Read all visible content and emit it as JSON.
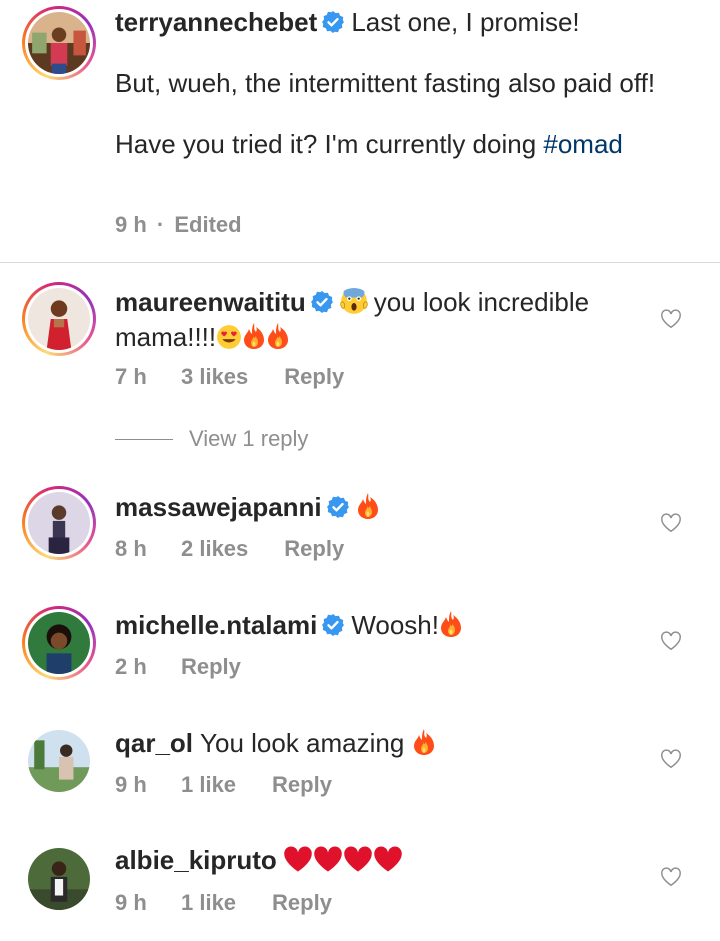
{
  "caption": {
    "username": "terryannechebet",
    "line1": "Last one, I promise!",
    "line2": "But, wueh, the intermittent fasting  also paid off!",
    "line3_prefix": "Have you tried it? I'm currently doing ",
    "hashtag": "#omad",
    "time": "9 h",
    "separator": "·",
    "edited": "Edited"
  },
  "comments": [
    {
      "username": "maureenwaititu",
      "text_prefix": "you look incredible mama!!!!",
      "time": "7 h",
      "likes": "3 likes",
      "reply": "Reply",
      "view_replies": "View 1 reply"
    },
    {
      "username": "massawejapanni",
      "time": "8 h",
      "likes": "2 likes",
      "reply": "Reply"
    },
    {
      "username": "michelle.ntalami",
      "text": "Woosh!",
      "time": "2 h",
      "reply": "Reply"
    },
    {
      "username": "qar_ol",
      "text": "You look amazing ",
      "time": "9 h",
      "likes": "1 like",
      "reply": "Reply"
    },
    {
      "username": "albie_kipruto",
      "time": "9 h",
      "likes": "1 like",
      "reply": "Reply"
    }
  ],
  "colors": {
    "verified": "#3897f0",
    "text": "#262626",
    "meta": "#8e8e8e",
    "hashtag": "#00376b"
  },
  "icons": [
    "verified-badge-icon",
    "heart-outline-icon",
    "fire-emoji-icon",
    "heart-eyes-emoji-icon",
    "scream-emoji-icon",
    "red-heart-emoji-icon"
  ]
}
